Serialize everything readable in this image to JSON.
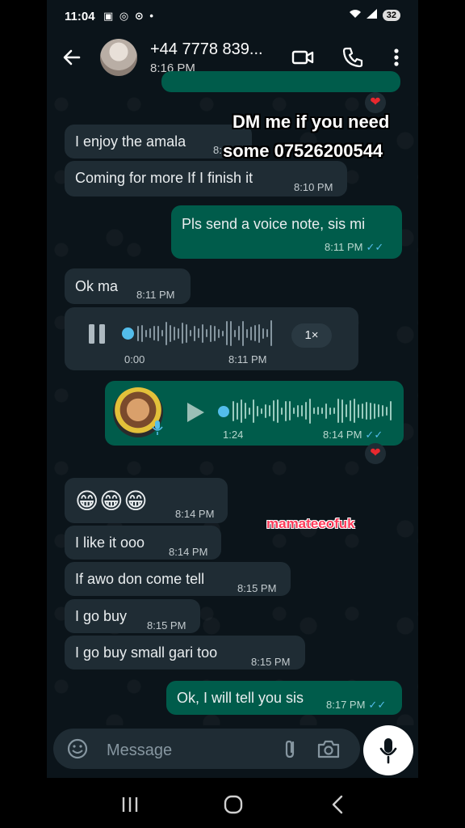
{
  "status_bar": {
    "time": "11:04",
    "battery": "32"
  },
  "header": {
    "contact_name": "+44 7778 839...",
    "last_seen": "8:16 PM"
  },
  "messages": [
    {
      "text": "I enjoy the amala",
      "time": "8:10 PM"
    },
    {
      "text": "Coming for more If I finish it",
      "time": "8:10 PM"
    },
    {
      "text": "Pls send a voice note, sis mi",
      "time": "8:11 PM"
    },
    {
      "text": "Ok ma",
      "time": "8:11 PM"
    },
    {
      "type": "voice",
      "duration": "0:00",
      "time": "8:11 PM",
      "speed": "1×",
      "progress": 0.0
    },
    {
      "type": "voice",
      "duration": "1:24",
      "time": "8:14 PM",
      "progress": 0.0
    },
    {
      "text": "😁😁😁",
      "time": "8:14 PM"
    },
    {
      "text": "I like it ooo",
      "time": "8:14 PM"
    },
    {
      "text": "If awo don come tell",
      "time": "8:15 PM"
    },
    {
      "text": "I go buy",
      "time": "8:15 PM"
    },
    {
      "text": "I go buy small gari too",
      "time": "8:15 PM"
    },
    {
      "text": "Ok, I will tell you sis",
      "time": "8:17 PM"
    }
  ],
  "overlay": {
    "line1": "DM me if you need",
    "line2": "some 07526200544",
    "watermark": "mamateeofuk"
  },
  "composer": {
    "placeholder": "Message"
  },
  "colors": {
    "incoming": "#1f2c34",
    "outgoing": "#005c4b",
    "background": "#0b141a",
    "read_ticks": "#53bdeb",
    "heart": "#e8282e"
  },
  "icons": [
    "back-arrow-icon",
    "video-call-icon",
    "phone-call-icon",
    "more-options-icon",
    "heart-reaction-icon",
    "pause-icon",
    "play-icon",
    "mic-icon",
    "emoji-icon",
    "attach-icon",
    "camera-icon",
    "recents-icon",
    "home-icon",
    "nav-back-icon"
  ]
}
